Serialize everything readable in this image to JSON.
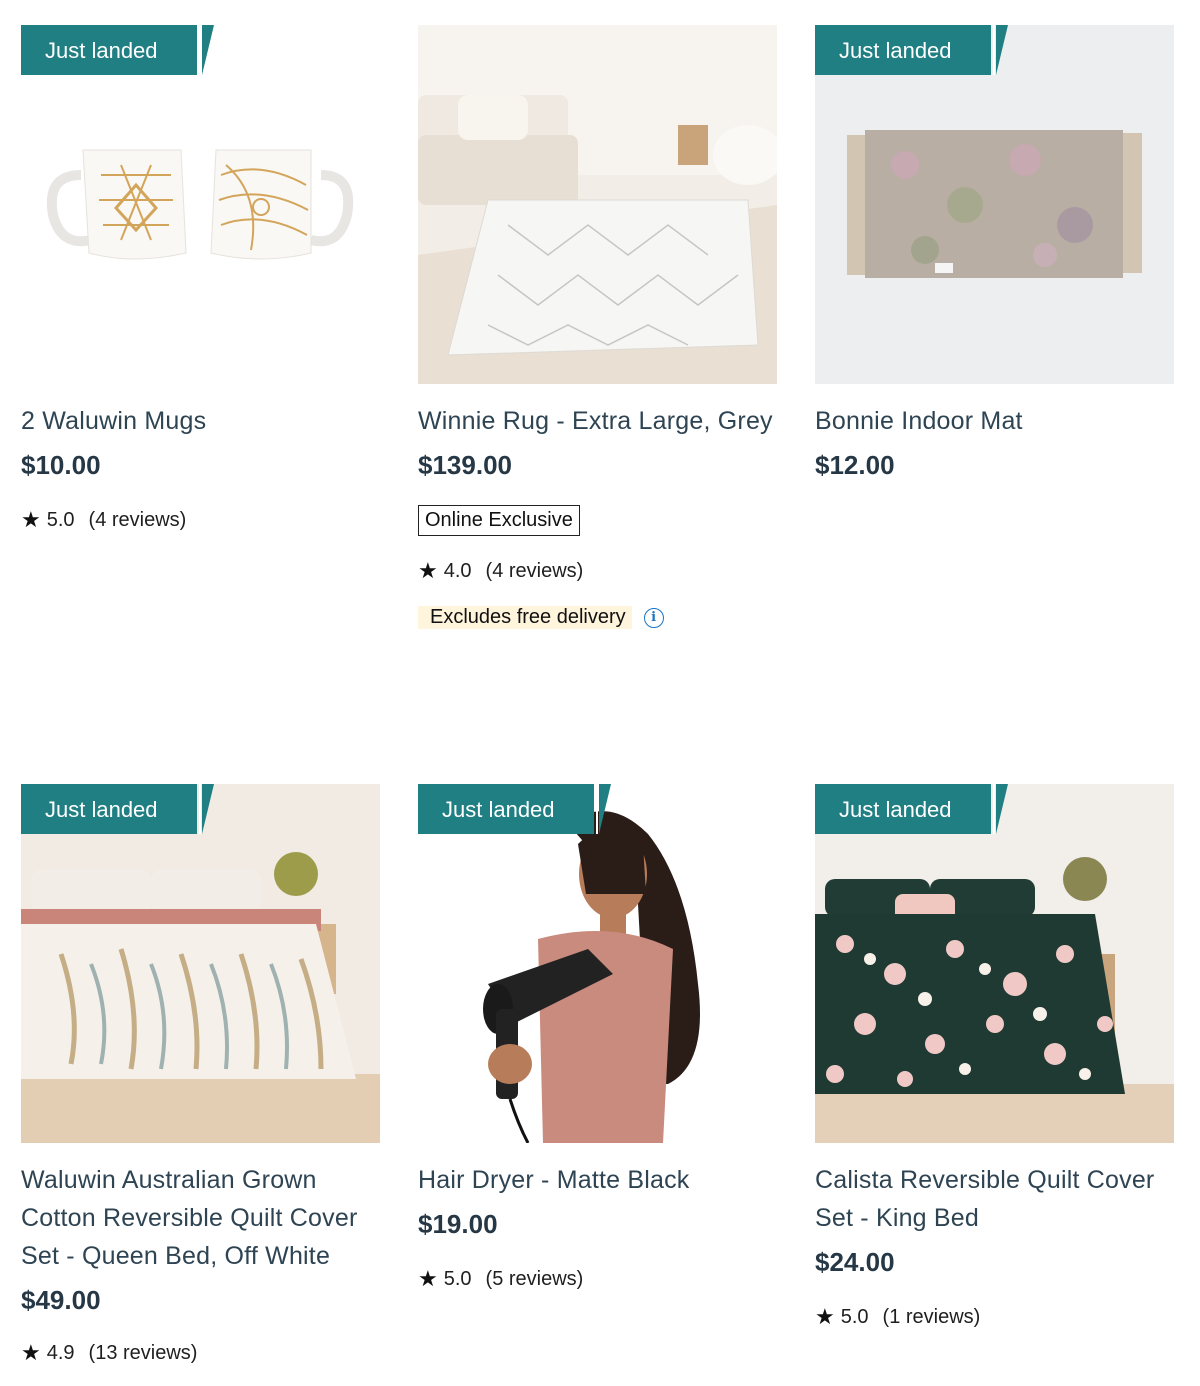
{
  "products": [
    {
      "badge": "Just landed",
      "title": "2 Waluwin Mugs",
      "price": "$10.00",
      "rating": "5.0",
      "reviews": "(4 reviews)"
    },
    {
      "title": "Winnie Rug - Extra Large, Grey",
      "price": "$139.00",
      "tag": "Online Exclusive",
      "rating": "4.0",
      "reviews": "(4 reviews)",
      "delivery_note": "Excludes free delivery"
    },
    {
      "badge": "Just landed",
      "title": "Bonnie Indoor Mat",
      "price": "$12.00"
    },
    {
      "badge": "Just landed",
      "title": "Waluwin Australian Grown Cotton Reversible Quilt Cover Set - Queen Bed, Off White",
      "price": "$49.00",
      "rating": "4.9",
      "reviews": "(13 reviews)"
    },
    {
      "badge": "Just landed",
      "title": "Hair Dryer - Matte Black",
      "price": "$19.00",
      "rating": "5.0",
      "reviews": "(5 reviews)"
    },
    {
      "badge": "Just landed",
      "title": "Calista Reversible Quilt Cover Set - King Bed",
      "price": "$24.00",
      "rating": "5.0",
      "reviews": "(1 reviews)"
    }
  ],
  "colors": {
    "badge": "#1f7f82",
    "price": "#263745",
    "info": "#1a75c4",
    "delivery_bg": "#fff4dc"
  },
  "icons": {
    "rating": "star-icon",
    "info": "info-icon"
  }
}
